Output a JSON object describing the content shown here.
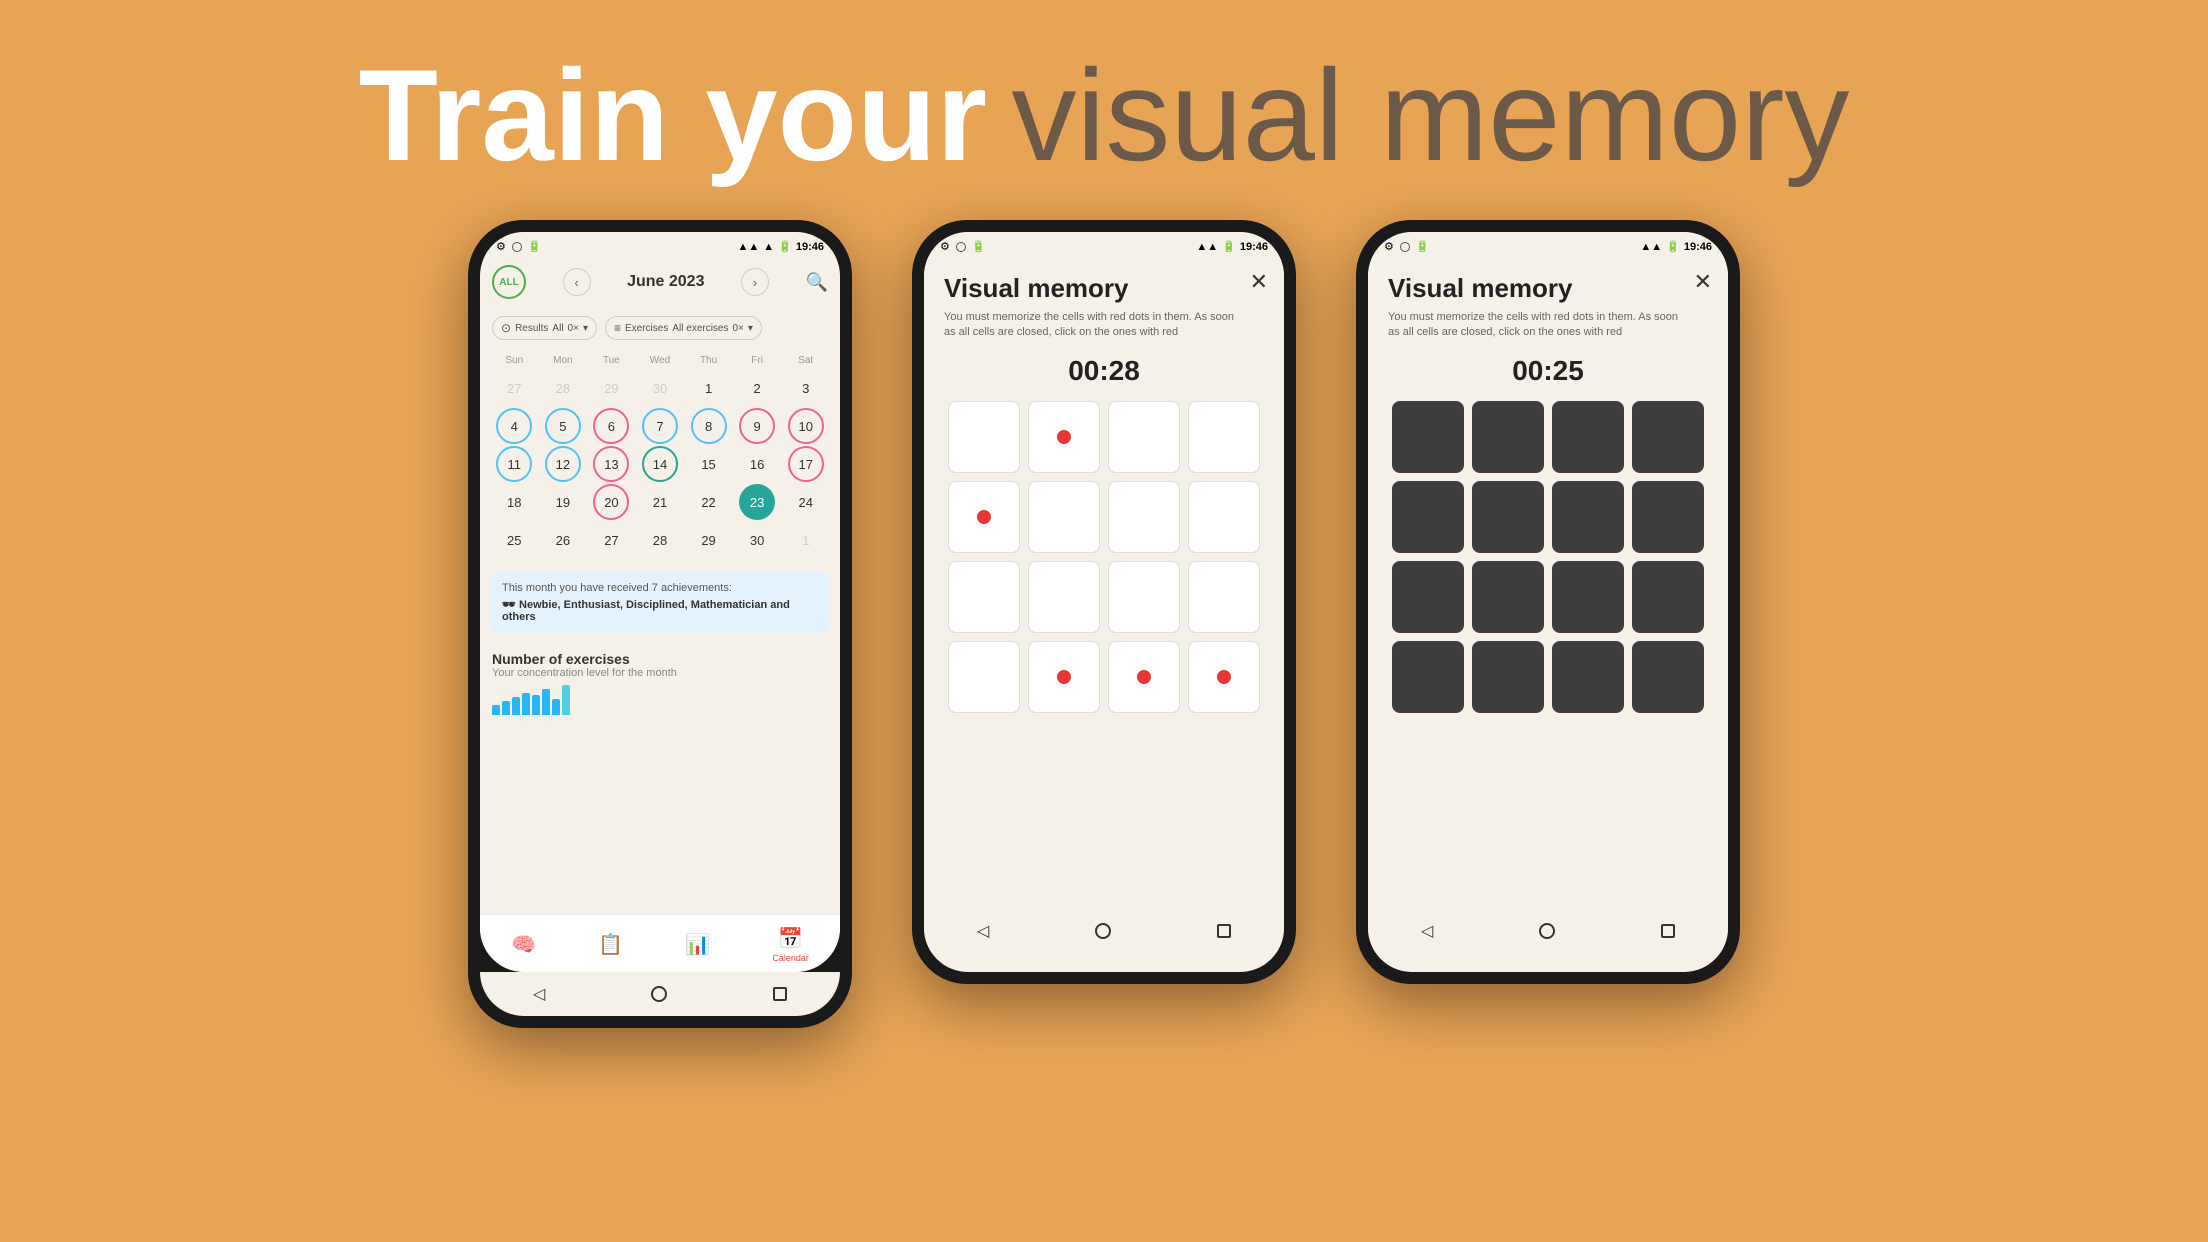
{
  "header": {
    "train": "Train your",
    "visual": "visual memory"
  },
  "phone1": {
    "status": {
      "time": "19:46"
    },
    "nav": {
      "month": "June 2023"
    },
    "filters": {
      "results_label": "Results",
      "results_value": "All",
      "results_count": "0×",
      "exercises_label": "Exercises",
      "exercises_value": "All exercises",
      "exercises_count": "0×"
    },
    "weekdays": [
      "Sun",
      "Mon",
      "Tue",
      "Wed",
      "Thu",
      "Fri",
      "Sat"
    ],
    "weeks": [
      [
        {
          "n": "27",
          "type": "other-month"
        },
        {
          "n": "28",
          "type": "other-month"
        },
        {
          "n": "29",
          "type": "other-month"
        },
        {
          "n": "30",
          "type": "other-month"
        },
        {
          "n": "1",
          "type": "normal"
        },
        {
          "n": "2",
          "type": "normal"
        },
        {
          "n": "3",
          "type": "normal"
        }
      ],
      [
        {
          "n": "4",
          "type": "circle-blue"
        },
        {
          "n": "5",
          "type": "circle-blue"
        },
        {
          "n": "6",
          "type": "circle-pink"
        },
        {
          "n": "7",
          "type": "circle-blue"
        },
        {
          "n": "8",
          "type": "circle-blue"
        },
        {
          "n": "9",
          "type": "circle-pink"
        },
        {
          "n": "10",
          "type": "circle-pink"
        }
      ],
      [
        {
          "n": "11",
          "type": "circle-blue"
        },
        {
          "n": "12",
          "type": "circle-blue"
        },
        {
          "n": "13",
          "type": "circle-pink"
        },
        {
          "n": "14",
          "type": "circle-teal"
        },
        {
          "n": "15",
          "type": "normal"
        },
        {
          "n": "16",
          "type": "normal"
        },
        {
          "n": "17",
          "type": "circle-pink"
        }
      ],
      [
        {
          "n": "18",
          "type": "normal"
        },
        {
          "n": "19",
          "type": "normal"
        },
        {
          "n": "20",
          "type": "circle-pink"
        },
        {
          "n": "21",
          "type": "normal"
        },
        {
          "n": "22",
          "type": "normal"
        },
        {
          "n": "23",
          "type": "filled-green"
        },
        {
          "n": "24",
          "type": "normal"
        }
      ],
      [
        {
          "n": "25",
          "type": "normal"
        },
        {
          "n": "26",
          "type": "normal"
        },
        {
          "n": "27",
          "type": "normal"
        },
        {
          "n": "28",
          "type": "normal"
        },
        {
          "n": "29",
          "type": "normal"
        },
        {
          "n": "30",
          "type": "normal"
        },
        {
          "n": "1",
          "type": "other-month"
        }
      ]
    ],
    "achievements": {
      "title": "This month you have received 7 achievements:",
      "text": "🕶 Newbie, Enthusiast, Disciplined, Mathematician and others"
    },
    "exercises": {
      "title": "Number of exercises",
      "subtitle": "Your concentration level for the month"
    },
    "bottom_nav": [
      {
        "icon": "🧠",
        "label": ""
      },
      {
        "icon": "📋",
        "label": ""
      },
      {
        "icon": "📊",
        "label": ""
      },
      {
        "icon": "📅",
        "label": "Calendar",
        "active": true
      }
    ]
  },
  "phone2": {
    "status": {
      "time": "19:46"
    },
    "title": "Visual memory",
    "desc": "You must memorize the cells with red dots in them. As soon as all cells are closed, click on the ones with red",
    "timer": "00:28",
    "grid": [
      [
        false,
        true,
        false,
        false
      ],
      [
        true,
        false,
        false,
        false
      ],
      [
        false,
        false,
        false,
        false
      ],
      [
        false,
        true,
        true,
        true
      ]
    ]
  },
  "phone3": {
    "status": {
      "time": "19:46"
    },
    "title": "Visual memory",
    "desc": "You must memorize the cells with red dots in them. As soon as all cells are closed, click on the ones with red",
    "timer": "00:25",
    "grid_dark": true
  }
}
